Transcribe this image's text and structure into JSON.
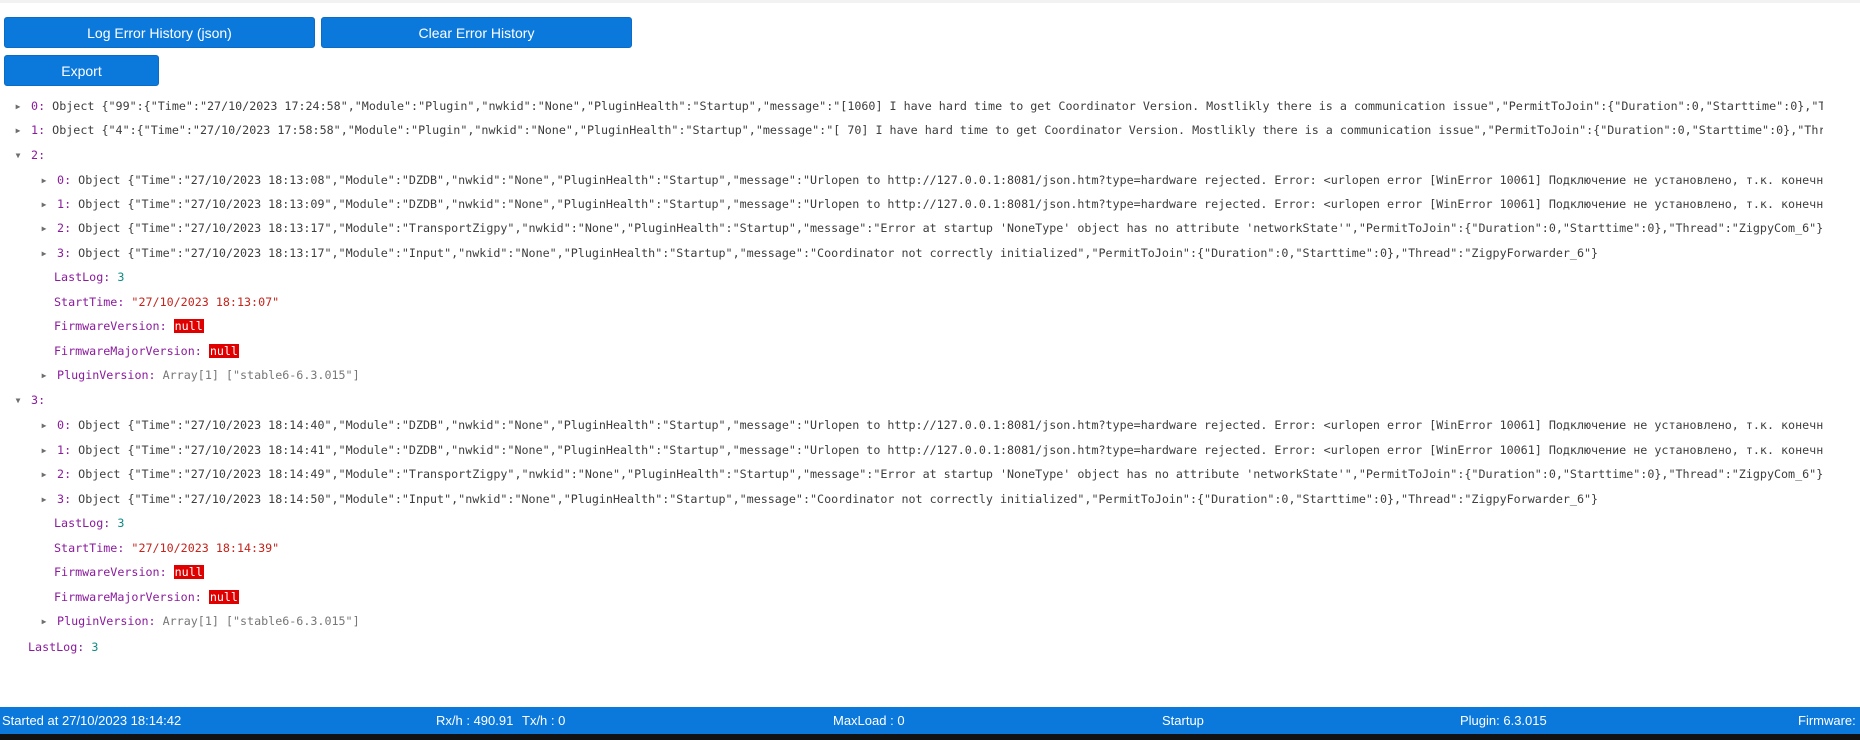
{
  "toolbar": {
    "log_error_history_label": "Log Error History (json)",
    "clear_error_history_label": "Clear Error History",
    "export_label": "Export"
  },
  "console": {
    "entry0": {
      "key": "0",
      "type": "Object",
      "preview": "{\"99\":{\"Time\":\"27/10/2023 17:24:58\",\"Module\":\"Plugin\",\"nwkid\":\"None\",\"PluginHealth\":\"Startup\",\"message\":\"[1060] I have hard time to get Coordinator Version. Mostlikly there is a communication issue\",\"PermitToJoin\":{\"Duration\":0,\"Starttime\":0},\"Thread\""
    },
    "entry1": {
      "key": "1",
      "type": "Object",
      "preview": "{\"4\":{\"Time\":\"27/10/2023 17:58:58\",\"Module\":\"Plugin\",\"nwkid\":\"None\",\"PluginHealth\":\"Startup\",\"message\":\"[ 70] I have hard time to get Coordinator Version. Mostlikly there is a communication issue\",\"PermitToJoin\":{\"Duration\":0,\"Starttime\":0},\"Thread\":\"M"
    },
    "entry2": {
      "key": "2",
      "items": [
        {
          "key": "0",
          "type": "Object",
          "preview": "{\"Time\":\"27/10/2023 18:13:08\",\"Module\":\"DZDB\",\"nwkid\":\"None\",\"PluginHealth\":\"Startup\",\"message\":\"Urlopen to http://127.0.0.1:8081/json.htm?type=hardware rejected. Error: <urlopen error [WinError 10061] Подключение не установлено, т.к. конечный ком"
        },
        {
          "key": "1",
          "type": "Object",
          "preview": "{\"Time\":\"27/10/2023 18:13:09\",\"Module\":\"DZDB\",\"nwkid\":\"None\",\"PluginHealth\":\"Startup\",\"message\":\"Urlopen to http://127.0.0.1:8081/json.htm?type=hardware rejected. Error: <urlopen error [WinError 10061] Подключение не установлено, т.к. конечный ком"
        },
        {
          "key": "2",
          "type": "Object",
          "preview": "{\"Time\":\"27/10/2023 18:13:17\",\"Module\":\"TransportZigpy\",\"nwkid\":\"None\",\"PluginHealth\":\"Startup\",\"message\":\"Error at startup 'NoneType' object has no attribute 'networkState'\",\"PermitToJoin\":{\"Duration\":0,\"Starttime\":0},\"Thread\":\"ZigpyCom_6\"}"
        },
        {
          "key": "3",
          "type": "Object",
          "preview": "{\"Time\":\"27/10/2023 18:13:17\",\"Module\":\"Input\",\"nwkid\":\"None\",\"PluginHealth\":\"Startup\",\"message\":\"Coordinator not correctly initialized\",\"PermitToJoin\":{\"Duration\":0,\"Starttime\":0},\"Thread\":\"ZigpyForwarder_6\"}"
        }
      ],
      "lastlog_key": "LastLog",
      "lastlog_value": "3",
      "starttime_key": "StartTime",
      "starttime_value": "\"27/10/2023 18:13:07\"",
      "firmware_key": "FirmwareVersion",
      "firmware_value": "null",
      "firmware_major_key": "FirmwareMajorVersion",
      "firmware_major_value": "null",
      "plugin_key": "PluginVersion",
      "plugin_value": "Array[1] [\"stable6-6.3.015\"]"
    },
    "entry3": {
      "key": "3",
      "items": [
        {
          "key": "0",
          "type": "Object",
          "preview": "{\"Time\":\"27/10/2023 18:14:40\",\"Module\":\"DZDB\",\"nwkid\":\"None\",\"PluginHealth\":\"Startup\",\"message\":\"Urlopen to http://127.0.0.1:8081/json.htm?type=hardware rejected. Error: <urlopen error [WinError 10061] Подключение не установлено, т.к. конечный ком"
        },
        {
          "key": "1",
          "type": "Object",
          "preview": "{\"Time\":\"27/10/2023 18:14:41\",\"Module\":\"DZDB\",\"nwkid\":\"None\",\"PluginHealth\":\"Startup\",\"message\":\"Urlopen to http://127.0.0.1:8081/json.htm?type=hardware rejected. Error: <urlopen error [WinError 10061] Подключение не установлено, т.к. конечный ком"
        },
        {
          "key": "2",
          "type": "Object",
          "preview": "{\"Time\":\"27/10/2023 18:14:49\",\"Module\":\"TransportZigpy\",\"nwkid\":\"None\",\"PluginHealth\":\"Startup\",\"message\":\"Error at startup 'NoneType' object has no attribute 'networkState'\",\"PermitToJoin\":{\"Duration\":0,\"Starttime\":0},\"Thread\":\"ZigpyCom_6\"}"
        },
        {
          "key": "3",
          "type": "Object",
          "preview": "{\"Time\":\"27/10/2023 18:14:50\",\"Module\":\"Input\",\"nwkid\":\"None\",\"PluginHealth\":\"Startup\",\"message\":\"Coordinator not correctly initialized\",\"PermitToJoin\":{\"Duration\":0,\"Starttime\":0},\"Thread\":\"ZigpyForwarder_6\"}"
        }
      ],
      "lastlog_key": "LastLog",
      "lastlog_value": "3",
      "starttime_key": "StartTime",
      "starttime_value": "\"27/10/2023 18:14:39\"",
      "firmware_key": "FirmwareVersion",
      "firmware_value": "null",
      "firmware_major_key": "FirmwareMajorVersion",
      "firmware_major_value": "null",
      "plugin_key": "PluginVersion",
      "plugin_value": "Array[1] [\"stable6-6.3.015\"]"
    },
    "root_lastlog_key": "LastLog",
    "root_lastlog_value": "3"
  },
  "statusbar": {
    "started": "Started at 27/10/2023 18:14:42",
    "rx": "Rx/h : 490.91",
    "tx": "Tx/h : 0",
    "maxload": "MaxLoad : 0",
    "state": "Startup",
    "plugin": "Plugin: 6.3.015",
    "firmware": "Firmware:"
  },
  "icons": {
    "expand": "triangle-right-icon",
    "collapse": "triangle-down-icon"
  },
  "colors": {
    "accent": "#0b78dc",
    "key": "#8b1b9d",
    "string": "#c4241b",
    "number": "#0d8b84",
    "null_bg": "#e00000"
  }
}
